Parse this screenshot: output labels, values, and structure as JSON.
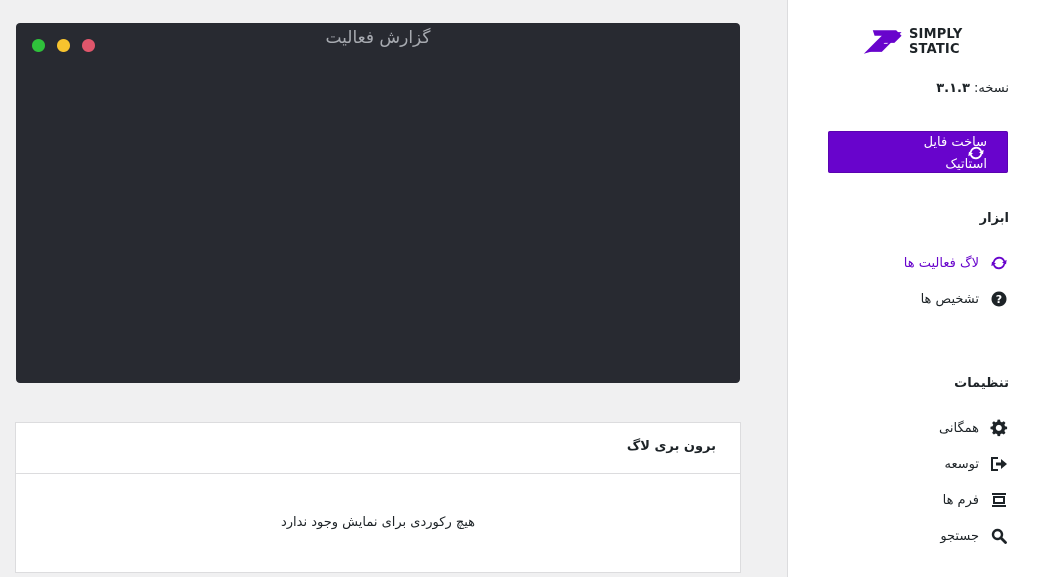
{
  "brand": {
    "logo_text": "SIMPLY STATIC",
    "accent_color": "#6804cc"
  },
  "version": {
    "label": "نسخه:",
    "number": "۳.۱.۳"
  },
  "build_button": {
    "label": "ساخت فایل استاتیک",
    "icon": "sync-icon"
  },
  "tools": {
    "title": "ابزار",
    "items": [
      {
        "label": "لاگ فعالیت ها",
        "icon": "sync-icon",
        "active": true
      },
      {
        "label": "تشخیص ها",
        "icon": "question-circle-icon",
        "active": false
      }
    ]
  },
  "settings": {
    "title": "تنظیمات",
    "items": [
      {
        "label": "همگانی",
        "icon": "gear-icon"
      },
      {
        "label": "توسعه",
        "icon": "export-icon"
      },
      {
        "label": "فرم ها",
        "icon": "form-icon"
      },
      {
        "label": "جستجو",
        "icon": "search-icon"
      }
    ]
  },
  "terminal": {
    "title": "گزارش فعالیت"
  },
  "log_export": {
    "title": "برون بری لاگ",
    "empty_message": "هیچ رکوردی برای نمایش وجود ندارد"
  }
}
